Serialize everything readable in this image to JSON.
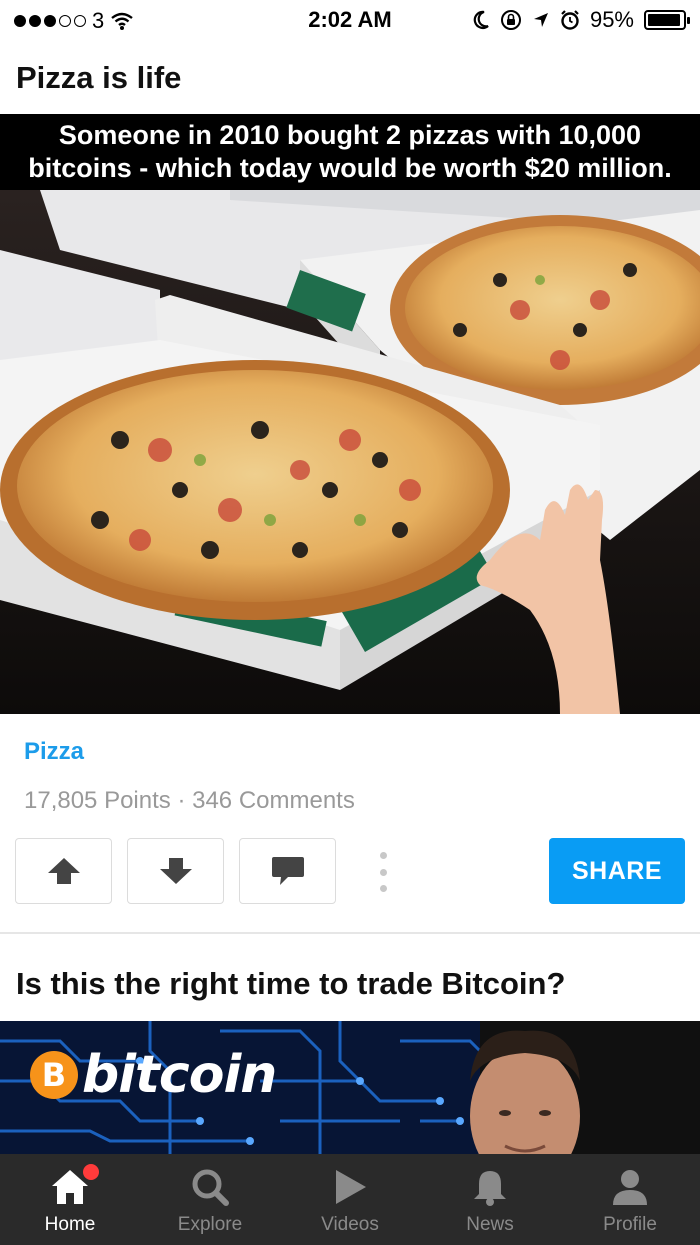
{
  "status_bar": {
    "carrier": "3",
    "time": "2:02 AM",
    "battery": "95%",
    "battery_level": 0.95
  },
  "post": {
    "title": "Pizza is life",
    "caption_line1": "Someone in 2010 bought 2 pizzas with 10,000",
    "caption_line2": "bitcoins - which today would be worth $20 million.",
    "section": "Pizza",
    "stats": "17,805 Points · 346 Comments",
    "share_label": "SHARE"
  },
  "next_post": {
    "title": "Is this the right time to trade Bitcoin?",
    "logo_coin": "B",
    "logo_word": "bitcoin"
  },
  "tabs": [
    {
      "label": "Home",
      "icon": "home-icon",
      "active": true
    },
    {
      "label": "Explore",
      "icon": "search-icon",
      "active": false
    },
    {
      "label": "Videos",
      "icon": "play-icon",
      "active": false
    },
    {
      "label": "News",
      "icon": "bell-icon",
      "active": false
    },
    {
      "label": "Profile",
      "icon": "person-icon",
      "active": false
    }
  ],
  "colors": {
    "accent": "#099cf4",
    "section": "#1c9cea",
    "tab_bar": "#2a2a2a",
    "notification": "#ff3b3b",
    "bitcoin": "#f7931a"
  }
}
